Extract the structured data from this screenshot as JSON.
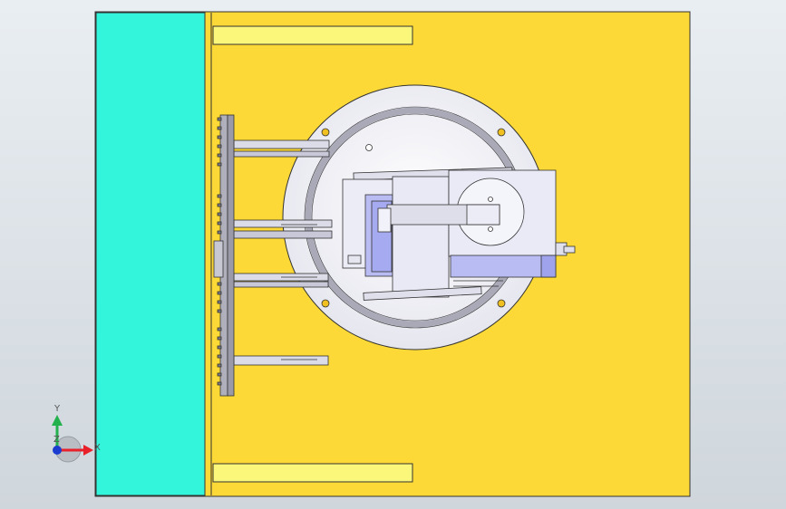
{
  "viewport": {
    "background_top": "#e9eef2",
    "background_bottom": "#cfd6dc"
  },
  "model": {
    "base_plate_color": "#fcd936",
    "side_block_color": "#33f5dc",
    "slot_color": "#fbf77a",
    "flange_color": "#f3f3f8",
    "ring_color": "#a9a9b8",
    "gearmotor_color": "#e9e9f6",
    "motor_blue": "#b9bcf2",
    "mount_hole_color": "#f0c020",
    "edge_color": "#333333"
  },
  "triad": {
    "x_label": "X",
    "y_label": "Y",
    "z_label": "Z",
    "x_color": "#e8202a",
    "y_color": "#22b14c",
    "z_color": "#1c3ccf"
  }
}
